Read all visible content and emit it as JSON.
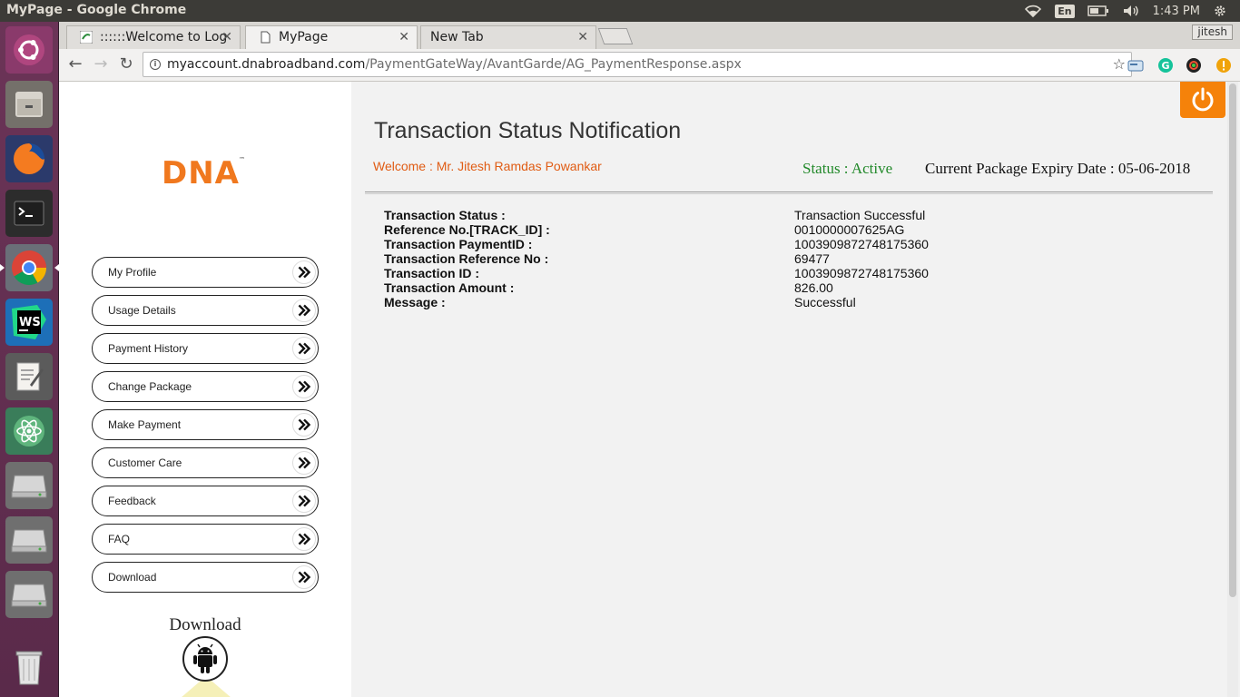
{
  "system": {
    "window_title": "MyPage - Google Chrome",
    "input_method": "En",
    "clock": "1:43 PM"
  },
  "launcher": {
    "items": [
      "ubuntu-dash",
      "files",
      "firefox",
      "terminal",
      "chrome",
      "webstorm",
      "text-editor",
      "atom",
      "drive-1",
      "drive-2",
      "drive-3",
      "trash"
    ]
  },
  "browser": {
    "tabs": [
      {
        "label": "::::::Welcome to Log",
        "active": false
      },
      {
        "label": "MyPage",
        "active": true
      },
      {
        "label": "New Tab",
        "active": false
      }
    ],
    "profile_name": "jitesh",
    "url_host": "myaccount.dnabroadband.com",
    "url_path": "/PaymentGateWay/AvantGarde/AG_PaymentResponse.aspx"
  },
  "sidebar": {
    "logo_text": "DNA",
    "logo_tm": "™",
    "menu": [
      {
        "label": "My Profile"
      },
      {
        "label": "Usage Details"
      },
      {
        "label": "Payment History"
      },
      {
        "label": "Change Package"
      },
      {
        "label": "Make Payment"
      },
      {
        "label": "Customer Care"
      },
      {
        "label": "Feedback"
      },
      {
        "label": "FAQ"
      },
      {
        "label": "Download"
      }
    ],
    "download_heading": "Download"
  },
  "main": {
    "title": "Transaction Status Notification",
    "welcome": "Welcome : Mr. Jitesh Ramdas Powankar",
    "status": "Status : Active",
    "expiry": "Current Package Expiry Date : 05-06-2018",
    "rows": [
      {
        "key": "Transaction Status :",
        "value": "Transaction Successful"
      },
      {
        "key": "Reference No.[TRACK_ID] :",
        "value": "0010000007625AG"
      },
      {
        "key": "Transaction PaymentID :",
        "value": "1003909872748175360"
      },
      {
        "key": "Transaction Reference No :",
        "value": "69477"
      },
      {
        "key": "Transaction ID :",
        "value": "1003909872748175360"
      },
      {
        "key": "Transaction Amount :",
        "value": "826.00"
      },
      {
        "key": "Message :",
        "value": "Successful"
      }
    ]
  },
  "colors": {
    "accent_orange": "#f5820a",
    "welcome_text": "#e05c14",
    "status_green": "#22892a"
  }
}
